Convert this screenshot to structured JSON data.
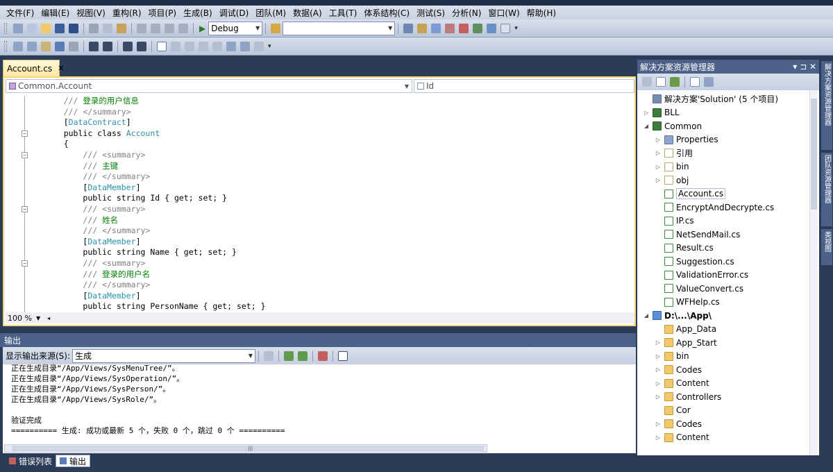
{
  "menu": [
    "文件(F)",
    "编辑(E)",
    "视图(V)",
    "重构(R)",
    "项目(P)",
    "生成(B)",
    "调试(D)",
    "团队(M)",
    "数据(A)",
    "工具(T)",
    "体系结构(C)",
    "测试(S)",
    "分析(N)",
    "窗口(W)",
    "帮助(H)"
  ],
  "toolbar": {
    "config_value": "Debug",
    "search_value": ""
  },
  "editor": {
    "tab_label": "Account.cs",
    "tab_close": "✕",
    "nav_type": "Common.Account",
    "nav_member": "Id",
    "zoom": "100 %"
  },
  "code_lines": [
    {
      "indent": "    ",
      "parts": [
        {
          "t": "/// ",
          "c": "gray"
        },
        {
          "t": "登录的用户信息",
          "c": "comment"
        }
      ]
    },
    {
      "indent": "    ",
      "parts": [
        {
          "t": "/// </summary>",
          "c": "gray"
        }
      ]
    },
    {
      "indent": "    ",
      "parts": [
        {
          "t": "[",
          "c": ""
        },
        {
          "t": "DataContract",
          "c": "type"
        },
        {
          "t": "]",
          "c": ""
        }
      ]
    },
    {
      "indent": "    ",
      "parts": [
        {
          "t": "public class ",
          "c": ""
        },
        {
          "t": "Account",
          "c": "type"
        }
      ]
    },
    {
      "indent": "    ",
      "parts": [
        {
          "t": "{",
          "c": ""
        }
      ]
    },
    {
      "indent": "        ",
      "parts": [
        {
          "t": "/// <summary>",
          "c": "gray"
        }
      ]
    },
    {
      "indent": "        ",
      "parts": [
        {
          "t": "/// ",
          "c": "gray"
        },
        {
          "t": "主键",
          "c": "comment"
        }
      ]
    },
    {
      "indent": "        ",
      "parts": [
        {
          "t": "/// </summary>",
          "c": "gray"
        }
      ]
    },
    {
      "indent": "        ",
      "parts": [
        {
          "t": "[",
          "c": ""
        },
        {
          "t": "DataMember",
          "c": "type"
        },
        {
          "t": "]",
          "c": ""
        }
      ]
    },
    {
      "indent": "        ",
      "parts": [
        {
          "t": "public string Id { get; set; }",
          "c": ""
        }
      ]
    },
    {
      "indent": "        ",
      "parts": [
        {
          "t": "/// <summary>",
          "c": "gray"
        }
      ]
    },
    {
      "indent": "        ",
      "parts": [
        {
          "t": "/// ",
          "c": "gray"
        },
        {
          "t": "姓名",
          "c": "comment"
        }
      ]
    },
    {
      "indent": "        ",
      "parts": [
        {
          "t": "/// </summary>",
          "c": "gray"
        }
      ]
    },
    {
      "indent": "        ",
      "parts": [
        {
          "t": "[",
          "c": ""
        },
        {
          "t": "DataMember",
          "c": "type"
        },
        {
          "t": "]",
          "c": ""
        }
      ]
    },
    {
      "indent": "        ",
      "parts": [
        {
          "t": "public string Name { get; set; }",
          "c": ""
        }
      ]
    },
    {
      "indent": "        ",
      "parts": [
        {
          "t": "/// <summary>",
          "c": "gray"
        }
      ]
    },
    {
      "indent": "        ",
      "parts": [
        {
          "t": "/// ",
          "c": "gray"
        },
        {
          "t": "登录的用户名",
          "c": "comment"
        }
      ]
    },
    {
      "indent": "        ",
      "parts": [
        {
          "t": "/// </summary>",
          "c": "gray"
        }
      ]
    },
    {
      "indent": "        ",
      "parts": [
        {
          "t": "[",
          "c": ""
        },
        {
          "t": "DataMember",
          "c": "type"
        },
        {
          "t": "]",
          "c": ""
        }
      ]
    },
    {
      "indent": "        ",
      "parts": [
        {
          "t": "public string PersonName { get; set; }",
          "c": ""
        }
      ]
    }
  ],
  "output": {
    "title": "输出",
    "source_label": "显示输出来源(S):",
    "source_value": "生成",
    "lines": [
      "正在生成目录“/App/Views/SysMenuTree/”。",
      "正在生成目录“/App/Views/SysOperation/”。",
      "正在生成目录“/App/Views/SysPerson/”。",
      "正在生成目录“/App/Views/SysRole/”。",
      "",
      "验证完成",
      "========== 生成: 成功或最新 5 个，失败 0 个，跳过 0 个 =========="
    ]
  },
  "bottom_tabs": [
    "错误列表",
    "输出"
  ],
  "solution_explorer": {
    "title": "解决方案资源管理器",
    "head_buttons": "▾ ⊐ ✕",
    "items": [
      {
        "label": "解决方案'Solution' (5 个项目)",
        "level": 0,
        "icon": "solution-icon",
        "arrow": ""
      },
      {
        "label": "BLL",
        "level": 0,
        "icon": "project-icon",
        "arrow": "▷"
      },
      {
        "label": "Common",
        "level": 0,
        "icon": "project-icon",
        "arrow": "◢"
      },
      {
        "label": "Properties",
        "level": 1,
        "icon": "properties-icon",
        "arrow": "▷"
      },
      {
        "label": "引用",
        "level": 1,
        "icon": "references-icon",
        "arrow": "▷"
      },
      {
        "label": "bin",
        "level": 1,
        "icon": "folder-empty-icon",
        "arrow": "▷"
      },
      {
        "label": "obj",
        "level": 1,
        "icon": "folder-empty-icon",
        "arrow": "▷"
      },
      {
        "label": "Account.cs",
        "level": 1,
        "icon": "cs-file-icon",
        "arrow": "",
        "selected": true
      },
      {
        "label": "EncryptAndDecrypte.cs",
        "level": 1,
        "icon": "cs-file-icon",
        "arrow": ""
      },
      {
        "label": "IP.cs",
        "level": 1,
        "icon": "cs-file-icon",
        "arrow": ""
      },
      {
        "label": "NetSendMail.cs",
        "level": 1,
        "icon": "cs-file-icon",
        "arrow": ""
      },
      {
        "label": "Result.cs",
        "level": 1,
        "icon": "cs-file-icon",
        "arrow": ""
      },
      {
        "label": "Suggestion.cs",
        "level": 1,
        "icon": "cs-file-icon",
        "arrow": ""
      },
      {
        "label": "ValidationError.cs",
        "level": 1,
        "icon": "cs-file-icon",
        "arrow": ""
      },
      {
        "label": "ValueConvert.cs",
        "level": 1,
        "icon": "cs-file-icon",
        "arrow": ""
      },
      {
        "label": "WFHelp.cs",
        "level": 1,
        "icon": "cs-file-icon",
        "arrow": ""
      },
      {
        "label": "D:\\...\\App\\",
        "level": 0,
        "icon": "web-project-icon",
        "arrow": "◢",
        "bold": true
      },
      {
        "label": "App_Data",
        "level": 1,
        "icon": "folder-icon",
        "arrow": ""
      },
      {
        "label": "App_Start",
        "level": 1,
        "icon": "folder-icon",
        "arrow": "▷"
      },
      {
        "label": "bin",
        "level": 1,
        "icon": "folder-icon",
        "arrow": "▷"
      },
      {
        "label": "Codes",
        "level": 1,
        "icon": "folder-icon",
        "arrow": "▷"
      },
      {
        "label": "Content",
        "level": 1,
        "icon": "folder-icon",
        "arrow": "▷"
      },
      {
        "label": "Controllers",
        "level": 1,
        "icon": "folder-icon",
        "arrow": "▷"
      },
      {
        "label": "Cor",
        "level": 1,
        "icon": "folder-icon",
        "arrow": ""
      },
      {
        "label": "Codes",
        "level": 1,
        "icon": "folder-icon",
        "arrow": "▷"
      },
      {
        "label": "Content",
        "level": 1,
        "icon": "folder-icon",
        "arrow": "▷"
      }
    ]
  },
  "side_tabs": [
    "解决方案资源管理器",
    "团队资源管理器",
    "类视图"
  ],
  "colors": {
    "comment": "#008000",
    "doc_gray": "#808080",
    "type": "#2b91af",
    "active_tab": "#ffe7a2",
    "panel_header": "#4b6188"
  }
}
